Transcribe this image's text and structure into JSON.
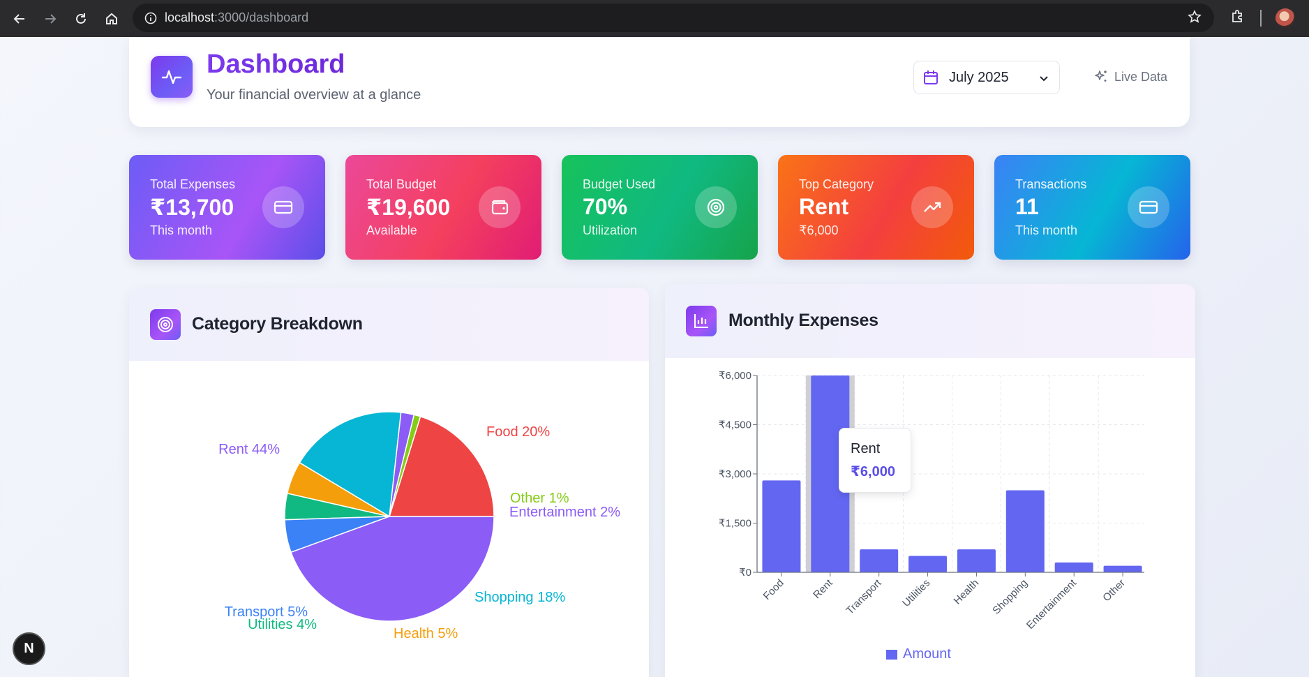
{
  "browser": {
    "url_host": "localhost",
    "url_path": ":3000/dashboard"
  },
  "header": {
    "title": "Dashboard",
    "subtitle": "Your financial overview at a glance",
    "month_value": "July 2025",
    "live_label": "Live Data"
  },
  "stats": [
    {
      "label": "Total Expenses",
      "value": "₹13,700",
      "sub": "This month",
      "icon": "credit-card-icon"
    },
    {
      "label": "Total Budget",
      "value": "₹19,600",
      "sub": "Available",
      "icon": "wallet-icon"
    },
    {
      "label": "Budget Used",
      "value": "70%",
      "sub": "Utilization",
      "icon": "target-icon"
    },
    {
      "label": "Top Category",
      "value": "Rent",
      "sub": "₹6,000",
      "icon": "trending-up-icon"
    },
    {
      "label": "Transactions",
      "value": "11",
      "sub": "This month",
      "icon": "credit-card-icon"
    }
  ],
  "colors": {
    "accent": "#7c3aed",
    "bar": "#6366f1"
  },
  "panels": {
    "category_title": "Category Breakdown",
    "monthly_title": "Monthly Expenses"
  },
  "chart_data": [
    {
      "type": "pie",
      "title": "Category Breakdown",
      "slices": [
        {
          "label": "Food 20%",
          "value": 20,
          "color": "#ef4444"
        },
        {
          "label": "Other 1%",
          "value": 1,
          "color": "#84cc16"
        },
        {
          "label": "Entertainment 2%",
          "value": 2,
          "color": "#8b5cf6"
        },
        {
          "label": "Shopping 18%",
          "value": 18,
          "color": "#06b6d4"
        },
        {
          "label": "Health 5%",
          "value": 5,
          "color": "#f59e0b"
        },
        {
          "label": "Utilities 4%",
          "value": 4,
          "color": "#10b981"
        },
        {
          "label": "Transport 5%",
          "value": 5,
          "color": "#3b82f6"
        },
        {
          "label": "Rent 44%",
          "value": 44,
          "color": "#8b5cf6"
        }
      ]
    },
    {
      "type": "bar",
      "title": "Monthly Expenses",
      "categories": [
        "Food",
        "Rent",
        "Transport",
        "Utilities",
        "Health",
        "Shopping",
        "Entertainment",
        "Other"
      ],
      "series": [
        {
          "name": "Amount",
          "values": [
            2800,
            6000,
            700,
            500,
            700,
            2500,
            300,
            200
          ]
        }
      ],
      "ylim": [
        0,
        6000
      ],
      "yticks": [
        "₹0",
        "₹1,500",
        "₹3,000",
        "₹4,500",
        "₹6,000"
      ],
      "grid": true,
      "legend": "bottom",
      "highlight": {
        "category": "Rent",
        "label": "Rent",
        "value_label": "₹6,000"
      }
    }
  ]
}
